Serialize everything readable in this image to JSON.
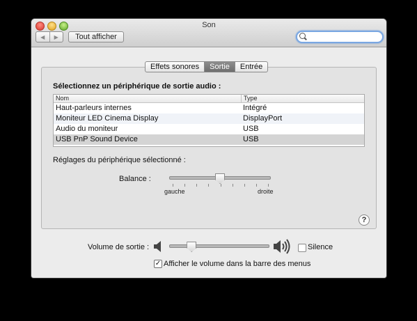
{
  "window": {
    "title": "Son"
  },
  "toolbar": {
    "back_glyph": "◀",
    "forward_glyph": "▶",
    "show_all_label": "Tout afficher",
    "search_placeholder": "",
    "search_value": ""
  },
  "tabs": [
    {
      "label": "Effets sonores",
      "active": false
    },
    {
      "label": "Sortie",
      "active": true
    },
    {
      "label": "Entrée",
      "active": false
    }
  ],
  "output": {
    "heading": "Sélectionnez un périphérique de sortie audio :",
    "columns": {
      "name": "Nom",
      "type": "Type"
    },
    "devices": [
      {
        "name": "Haut-parleurs internes",
        "type": "Intégré"
      },
      {
        "name": "Moniteur LED Cinema Display",
        "type": "DisplayPort"
      },
      {
        "name": "Audio du moniteur",
        "type": "USB"
      },
      {
        "name": "USB PnP Sound Device",
        "type": "USB"
      }
    ],
    "selected_index": 3,
    "settings_label": "Réglages du périphérique sélectionné :",
    "balance": {
      "label": "Balance :",
      "left_label": "gauche",
      "right_label": "droite",
      "value": 0.5
    },
    "help_glyph": "?"
  },
  "volume": {
    "label": "Volume de sortie :",
    "value": 0.22,
    "mute_label": "Silence",
    "mute_checked": false,
    "show_in_menubar_label": "Afficher le volume dans la barre des menus",
    "show_in_menubar_checked": true,
    "checkmark_glyph": "✓"
  },
  "icons": {
    "speaker_low": "speaker-low-icon",
    "speaker_high": "speaker-high-icon",
    "search": "magnifier-icon"
  },
  "colors": {
    "window_bg": "#ececec",
    "selected_row": "#d4d4d4",
    "active_tab": "#7a7a7a",
    "search_focus": "#7aa7e2"
  }
}
